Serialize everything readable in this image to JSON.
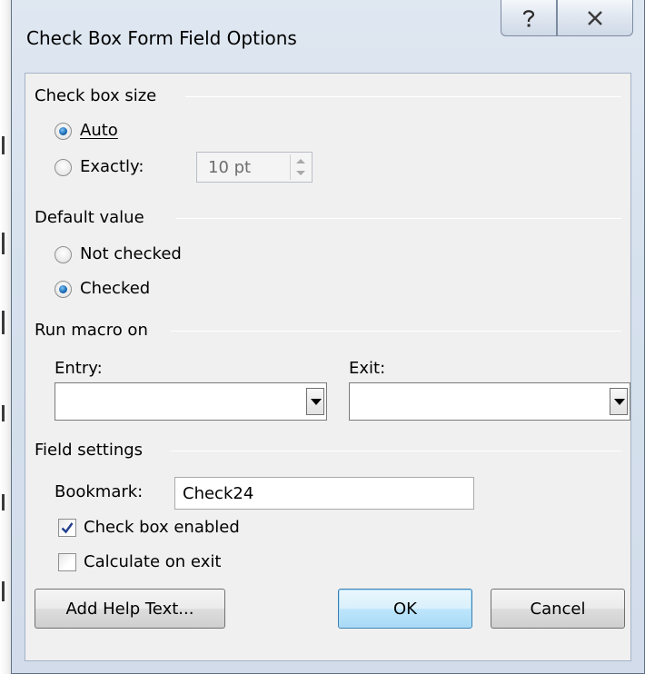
{
  "window": {
    "title": "Check Box Form Field Options"
  },
  "size_group": {
    "heading": "Check box size",
    "auto_label": "Auto",
    "exactly_label": "Exactly:",
    "exact_value": "10 pt",
    "selected": "auto"
  },
  "default_group": {
    "heading": "Default value",
    "not_checked_label": "Not checked",
    "checked_label": "Checked",
    "selected": "checked"
  },
  "macro_group": {
    "heading": "Run macro on",
    "entry_label": "Entry:",
    "exit_label": "Exit:",
    "entry_value": "",
    "exit_value": ""
  },
  "field_group": {
    "heading": "Field settings",
    "bookmark_label": "Bookmark:",
    "bookmark_value": "Check24",
    "enabled_label": "Check box enabled",
    "enabled_checked": true,
    "calc_label": "Calculate on exit",
    "calc_checked": false
  },
  "buttons": {
    "help_text": "Add Help Text...",
    "ok": "OK",
    "cancel": "Cancel"
  },
  "colors": {
    "accent": "#1d6fb8",
    "window_frame": "#d6e1ee",
    "client_bg": "#f0f0f0"
  }
}
